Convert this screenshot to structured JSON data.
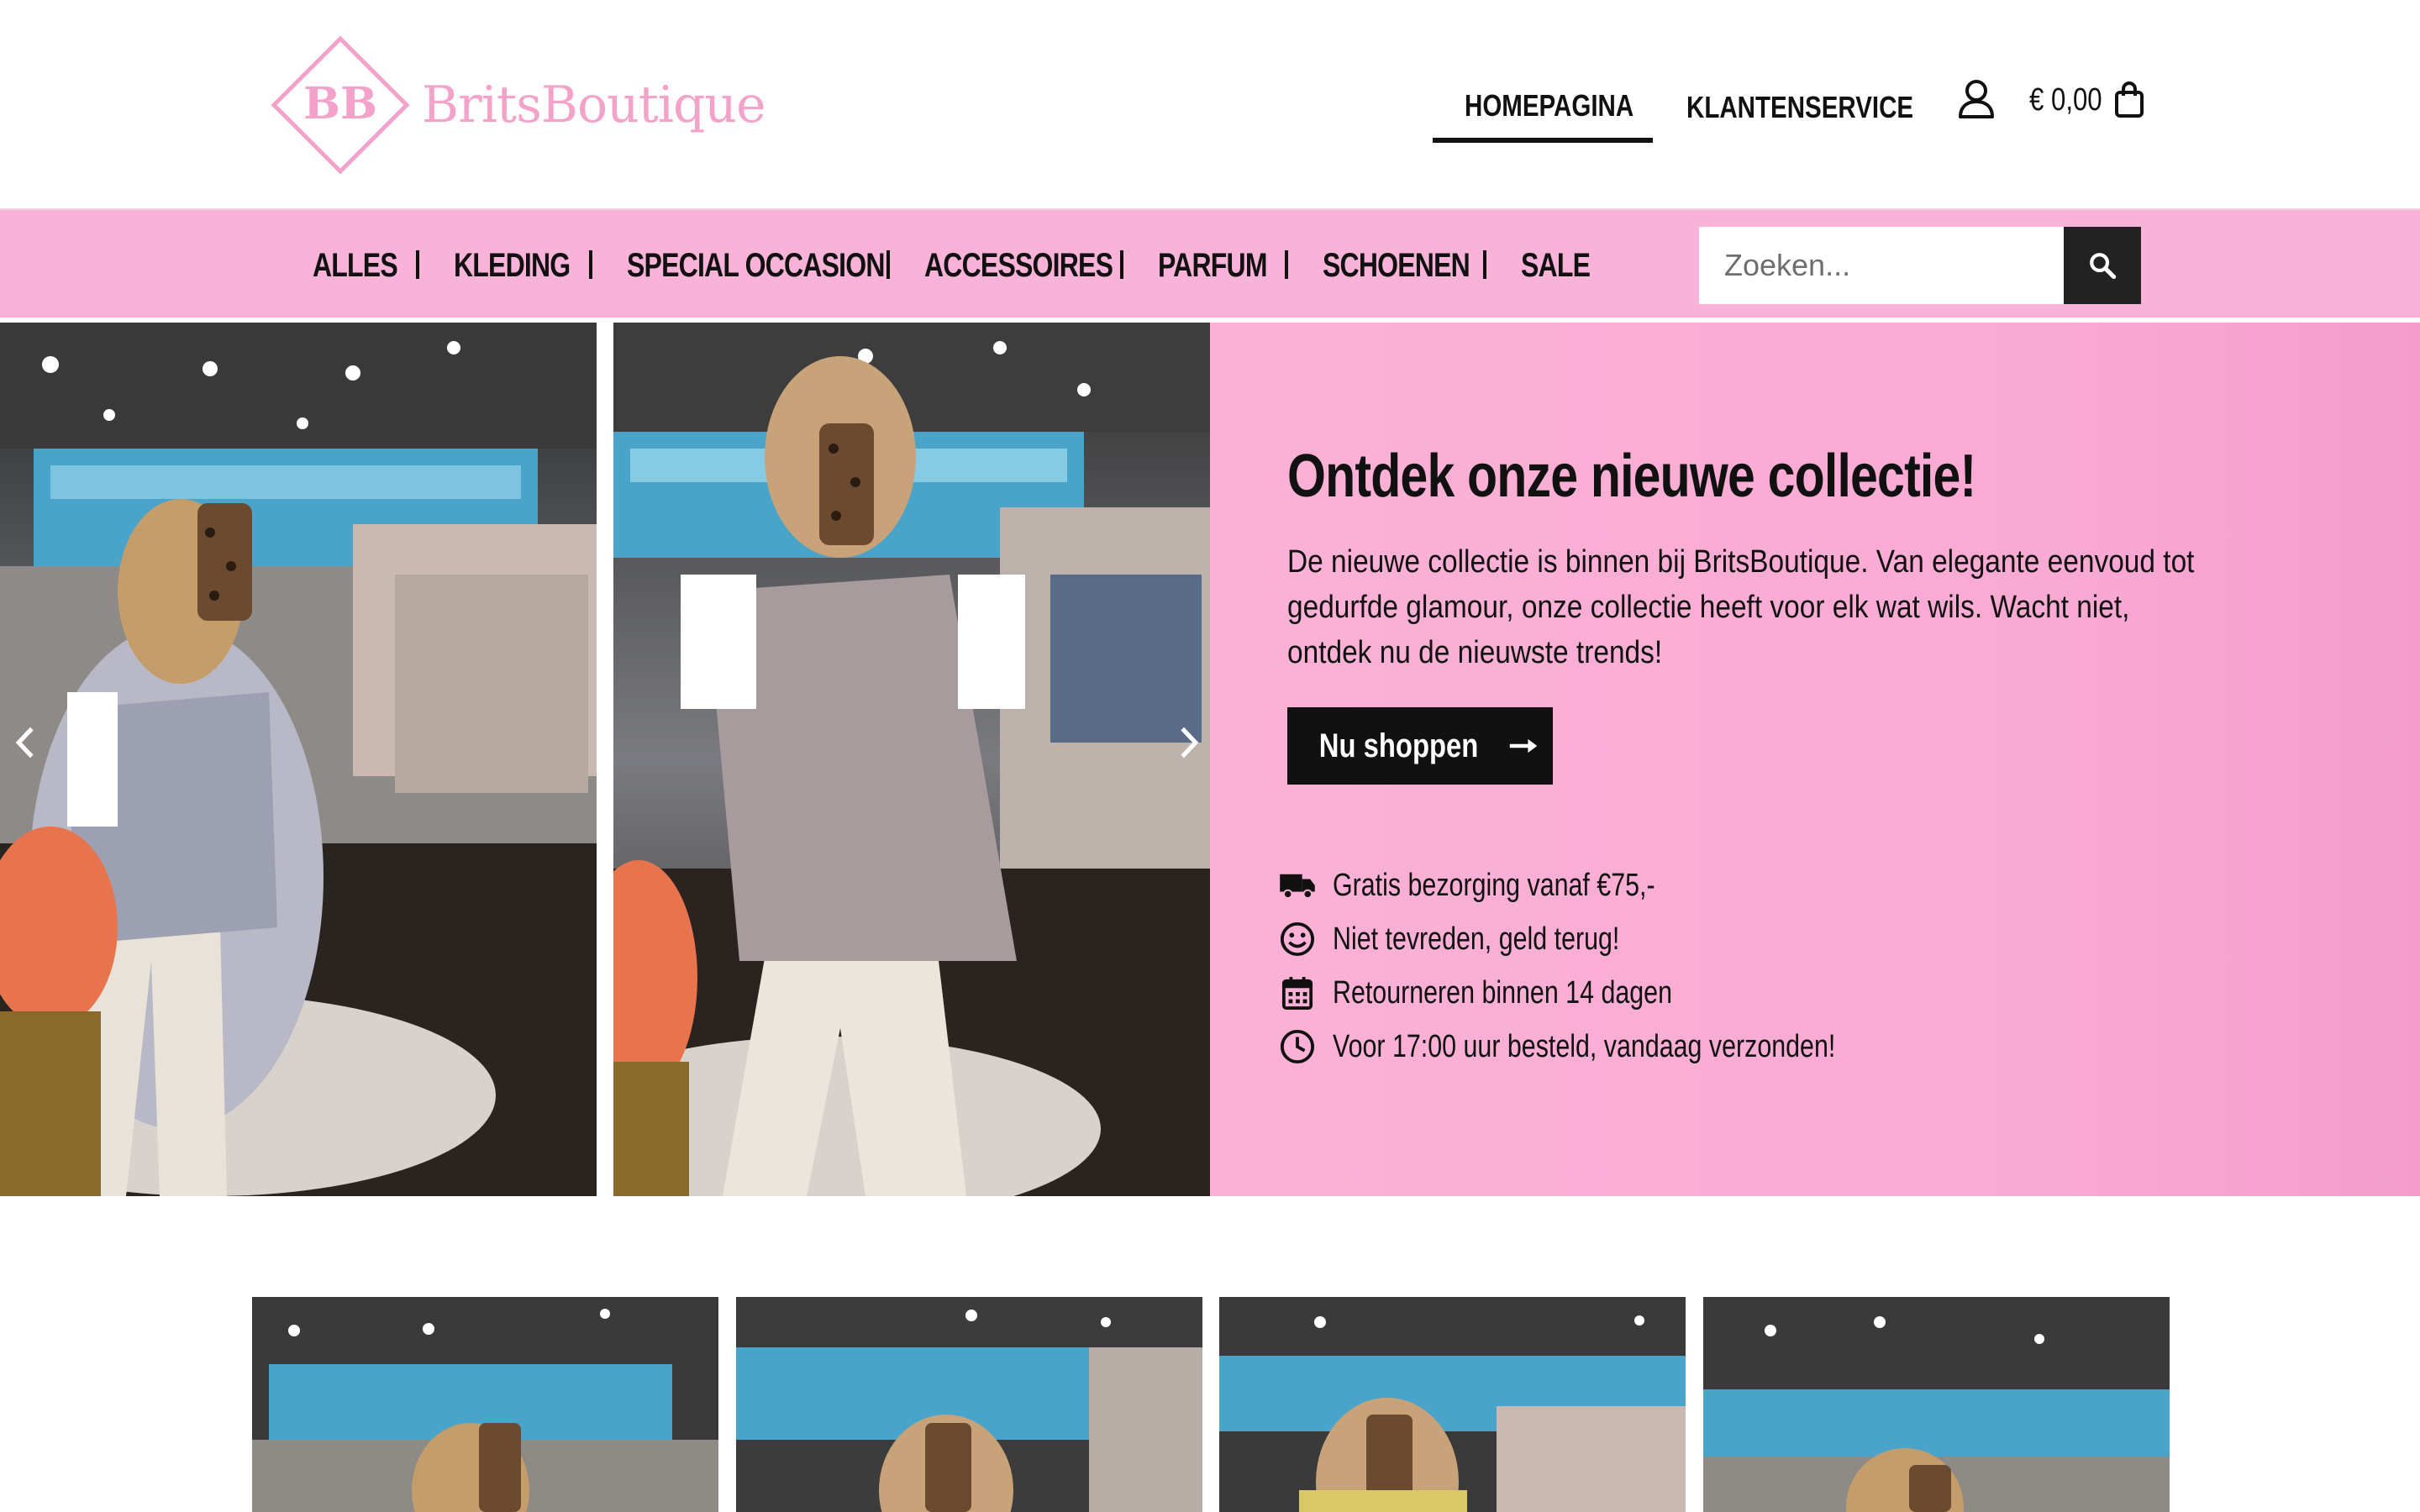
{
  "brand": {
    "monogram": "BB",
    "name": "BritsBoutique",
    "color": "#f3a3c9"
  },
  "topnav": {
    "home": "HOMEPAGINA",
    "service": "KLANTENSERVICE",
    "account_icon": "user-icon",
    "cart_total": "€ 0,00",
    "cart_icon": "shopping-bag-icon"
  },
  "categories": [
    "ALLES",
    "KLEDING",
    "SPECIAL OCCASION",
    "ACCESSOIRES",
    "PARFUM",
    "SCHOENEN",
    "SALE"
  ],
  "search": {
    "placeholder": "Zoeken...",
    "icon": "search-icon"
  },
  "hero": {
    "title": "Ontdek onze nieuwe collectie!",
    "text": "De nieuwe collectie is binnen bij BritsBoutique. Van elegante eenvoud tot gedurfde glamour, onze collectie heeft voor elk wat wils. Wacht niet, ontdek nu de nieuwste trends!",
    "button": "Nu shoppen",
    "button_icon": "arrow-right-icon",
    "usps": [
      {
        "icon": "truck-icon",
        "text": "Gratis bezorging vanaf €75,-"
      },
      {
        "icon": "smile-icon",
        "text": "Niet tevreden, geld terug!"
      },
      {
        "icon": "calendar-icon",
        "text": "Retourneren binnen 14 dagen"
      },
      {
        "icon": "clock-icon",
        "text": "Voor 17:00 uur besteld, vandaag verzonden!"
      }
    ]
  },
  "colors": {
    "pink_bar": "#f9b3d8",
    "hero_pink": "#fbb2d6",
    "dark": "#111111"
  }
}
